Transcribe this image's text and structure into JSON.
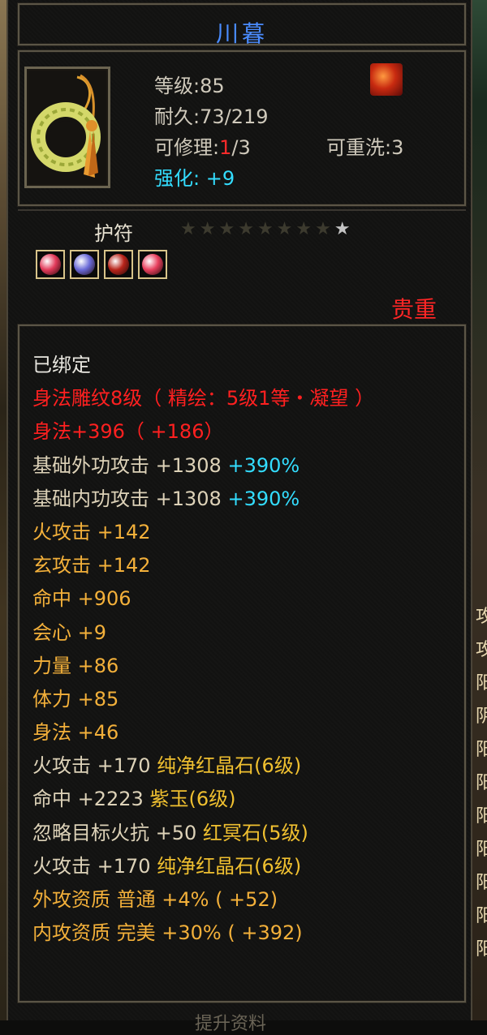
{
  "item": {
    "name": "川暮",
    "level": "等级:85",
    "durability": "耐久:73/219",
    "repair_prefix": "可修理:",
    "repair_current": "1",
    "repair_suffix": "/3",
    "rewash": "可重洗:3",
    "enhance_label": "强化:",
    "enhance_value": "+9",
    "type": "护符",
    "stars_total": 9,
    "stars_lit": 1,
    "rarity": "贵重",
    "badge_icon": "flame-emblem-icon",
    "gems": [
      {
        "icon": "red-gem-icon",
        "color": "#e23a5a"
      },
      {
        "icon": "blue-gem-icon",
        "color": "#6a6ad8"
      },
      {
        "icon": "crimson-gem-icon",
        "color": "#b8241a"
      },
      {
        "icon": "red-gem-icon",
        "color": "#e8405e"
      }
    ]
  },
  "attributes": [
    {
      "text": "已绑定",
      "color": "white"
    },
    {
      "text": "身法雕纹8级（ 精绘：5级1等・凝望 ）",
      "color": "red"
    },
    {
      "text": "身法+396（ +186）",
      "color": "red"
    },
    {
      "text": "基础外功攻击 +1308 ",
      "suffix": "+390%",
      "color": "beige"
    },
    {
      "text": "基础内功攻击 +1308 ",
      "suffix": "+390%",
      "color": "beige"
    },
    {
      "text": "火攻击 +142",
      "color": "orange"
    },
    {
      "text": "玄攻击 +142",
      "color": "orange"
    },
    {
      "text": "命中 +906",
      "color": "orange"
    },
    {
      "text": "会心 +9",
      "color": "orange"
    },
    {
      "text": "力量 +86",
      "color": "orange"
    },
    {
      "text": "体力 +85",
      "color": "orange"
    },
    {
      "text": "身法 +46",
      "color": "orange"
    },
    {
      "text": "火攻击 +170 ",
      "suffix_gold": "纯净红晶石(6级)",
      "color": "beige"
    },
    {
      "text": "命中 +2223 ",
      "suffix_gold": "紫玉(6级)",
      "color": "beige"
    },
    {
      "text": "忽略目标火抗 +50 ",
      "suffix_gold": "红冥石(5级)",
      "color": "beige"
    },
    {
      "text": "火攻击 +170 ",
      "suffix_gold": "纯净红晶石(6级)",
      "color": "beige"
    },
    {
      "text": "外攻资质  普通 +4% ( +52)",
      "color": "orange"
    },
    {
      "text": "内攻资质  完美 +30% ( +392)",
      "color": "orange"
    }
  ],
  "footer_partial": "提升资料",
  "background_right_text": [
    "攻",
    "攻",
    "阳",
    "阴",
    "阳",
    "阳",
    "阳",
    "阳",
    "阳",
    "阳",
    "阳"
  ]
}
